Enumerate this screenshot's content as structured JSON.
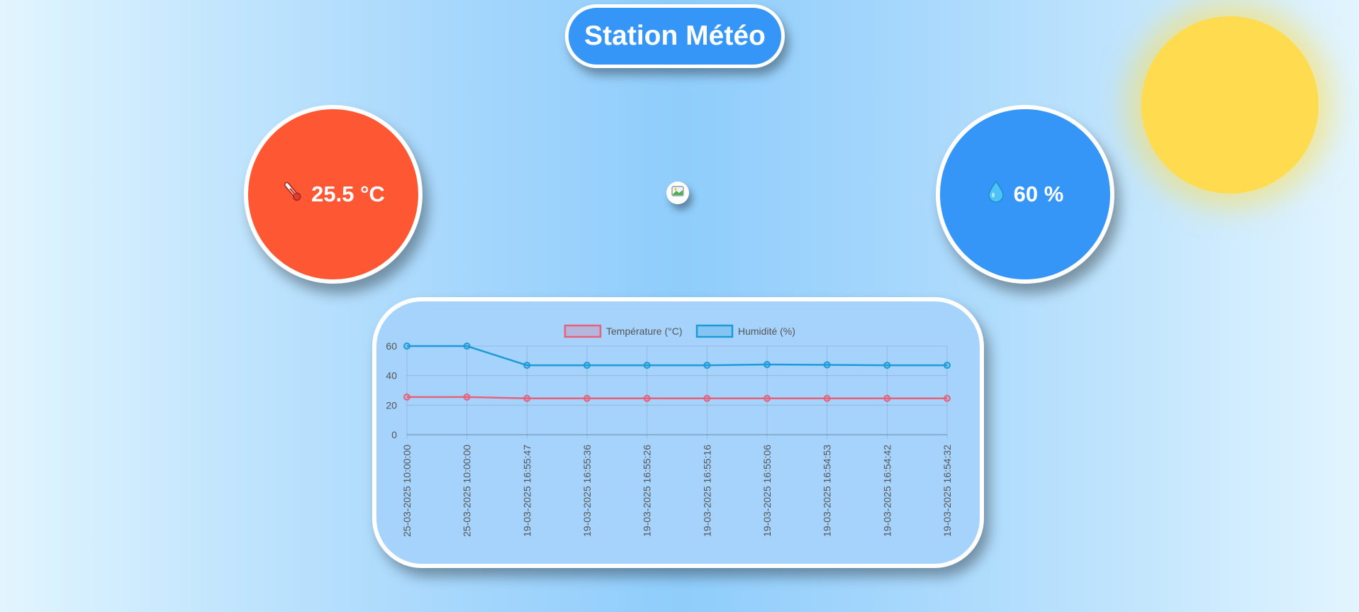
{
  "title": "Station Météo",
  "temperature": {
    "value": "25.5 °C",
    "icon": "thermometer-icon"
  },
  "humidity": {
    "value": "60 %",
    "icon": "droplet-icon"
  },
  "center_button": {
    "icon": "weather-image-icon"
  },
  "colors": {
    "temperature": "#fe5733",
    "humidity": "#3596f7",
    "sun": "#ffdc4f",
    "temp_line": "#e8617a",
    "hum_line": "#1e9ad6"
  },
  "chart_data": {
    "type": "line",
    "x": [
      "25-03-2025 10:00:00",
      "25-03-2025 10:00:00",
      "19-03-2025 16:55:47",
      "19-03-2025 16:55:36",
      "19-03-2025 16:55:26",
      "19-03-2025 16:55:16",
      "19-03-2025 16:55:06",
      "19-03-2025 16:54:53",
      "19-03-2025 16:54:42",
      "19-03-2025 16:54:32"
    ],
    "series": [
      {
        "name": "Température (°C)",
        "values": [
          25.5,
          25.5,
          24.6,
          24.6,
          24.6,
          24.6,
          24.6,
          24.6,
          24.6,
          24.6
        ]
      },
      {
        "name": "Humidité (%)",
        "values": [
          60,
          60,
          47,
          47,
          47,
          47,
          47.5,
          47.3,
          47,
          47
        ]
      }
    ],
    "ylim": [
      0,
      60
    ],
    "yticks": [
      0,
      20,
      40,
      60
    ],
    "grid": true,
    "legend": "top"
  }
}
